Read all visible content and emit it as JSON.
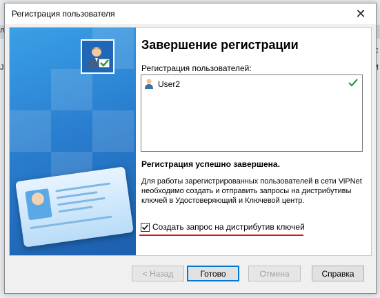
{
  "background": {
    "left_fragments": [
      "ль:",
      "",
      "Jse"
    ],
    "right_fragments": [
      "C",
      "M"
    ]
  },
  "dialog": {
    "title": "Регистрация пользователя",
    "close_glyph": "✕"
  },
  "content": {
    "heading": "Завершение регистрации",
    "list_label": "Регистрация пользователей:",
    "users": [
      {
        "name": "User2",
        "status": "ok"
      }
    ],
    "success_text": "Регистрация успешно завершена.",
    "info_text": "Для работы зарегистрированных пользователей в сети ViPNet необходимо создать и отправить запросы на дистрибутивы ключей в Удостоверяющий и Ключевой центр.",
    "checkbox_label": "Создать запрос на дистрибутив ключей",
    "checkbox_checked": true
  },
  "buttons": {
    "back": "< Назад",
    "done": "Готово",
    "cancel": "Отмена",
    "help": "Справка"
  },
  "colors": {
    "banner": "#2a7fd0",
    "accent_underline": "#dd1111",
    "check_green": "#2e9e2e"
  },
  "icons": {
    "banner_logo": "user-check-icon",
    "list_user": "user-icon",
    "list_status": "checkmark-icon"
  }
}
